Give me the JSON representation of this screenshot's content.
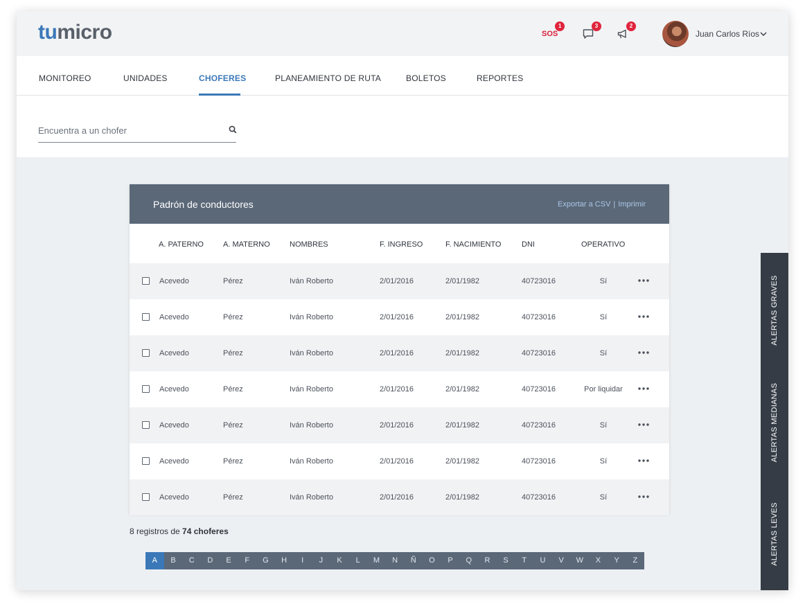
{
  "header": {
    "logo_tu": "tu",
    "logo_micro": "micro",
    "sos_label": "SOS",
    "sos_count": "1",
    "messages_count": "3",
    "announcements_count": "2",
    "user_name": "Juan Carlos Ríos"
  },
  "nav": {
    "items": [
      {
        "label": "MONITOREO"
      },
      {
        "label": "UNIDADES"
      },
      {
        "label": "CHOFERES"
      },
      {
        "label": "PLANEAMIENTO DE RUTA"
      },
      {
        "label": "BOLETOS"
      },
      {
        "label": "REPORTES"
      }
    ],
    "active": "CHOFERES"
  },
  "search": {
    "placeholder": "Encuentra a un chofer",
    "value": ""
  },
  "table": {
    "title": "Padrón de conductores",
    "export_label": "Exportar a CSV",
    "separator": "|",
    "print_label": "Imprimir",
    "columns": [
      "A. PATERNO",
      "A. MATERNO",
      "NOMBRES",
      "F. INGRESO",
      "F. NACIMIENTO",
      "DNI",
      "OPERATIVO"
    ],
    "rows": [
      {
        "paterno": "Acevedo",
        "materno": "Pérez",
        "nombres": "Iván Roberto",
        "ingreso": "2/01/2016",
        "nacimiento": "2/01/1982",
        "dni": "40723016",
        "operativo": "Sí"
      },
      {
        "paterno": "Acevedo",
        "materno": "Pérez",
        "nombres": "Iván Roberto",
        "ingreso": "2/01/2016",
        "nacimiento": "2/01/1982",
        "dni": "40723016",
        "operativo": "Sí"
      },
      {
        "paterno": "Acevedo",
        "materno": "Pérez",
        "nombres": "Iván Roberto",
        "ingreso": "2/01/2016",
        "nacimiento": "2/01/1982",
        "dni": "40723016",
        "operativo": "Sí"
      },
      {
        "paterno": "Acevedo",
        "materno": "Pérez",
        "nombres": "Iván Roberto",
        "ingreso": "2/01/2016",
        "nacimiento": "2/01/1982",
        "dni": "40723016",
        "operativo": "Por liquidar"
      },
      {
        "paterno": "Acevedo",
        "materno": "Pérez",
        "nombres": "Iván Roberto",
        "ingreso": "2/01/2016",
        "nacimiento": "2/01/1982",
        "dni": "40723016",
        "operativo": "Sí"
      },
      {
        "paterno": "Acevedo",
        "materno": "Pérez",
        "nombres": "Iván Roberto",
        "ingreso": "2/01/2016",
        "nacimiento": "2/01/1982",
        "dni": "40723016",
        "operativo": "Sí"
      },
      {
        "paterno": "Acevedo",
        "materno": "Pérez",
        "nombres": "Iván Roberto",
        "ingreso": "2/01/2016",
        "nacimiento": "2/01/1982",
        "dni": "40723016",
        "operativo": "Sí"
      }
    ]
  },
  "records": {
    "prefix": "8 registros de",
    "total": "74 choferes"
  },
  "alphabet": {
    "letters": [
      "A",
      "B",
      "C",
      "D",
      "E",
      "F",
      "G",
      "H",
      "I",
      "J",
      "K",
      "L",
      "M",
      "N",
      "Ñ",
      "O",
      "P",
      "Q",
      "R",
      "S",
      "T",
      "U",
      "V",
      "W",
      "X",
      "Y",
      "Z"
    ],
    "active": "A"
  },
  "alerts": {
    "graves": "ALERTAS GRAVES",
    "medianas": "ALERTAS MEDIANAS",
    "leves": "ALERTAS LEVES"
  },
  "colors": {
    "brand_blue": "#3b78b8",
    "header_slate": "#5b6878",
    "sidebar_dark": "#353c46",
    "badge_red": "#e0243c"
  },
  "icons": {
    "messages": "chat-bubble-icon",
    "announcements": "megaphone-icon",
    "search": "search-icon",
    "menu": "chevron-down-icon",
    "row_actions": "more-dots-icon"
  }
}
